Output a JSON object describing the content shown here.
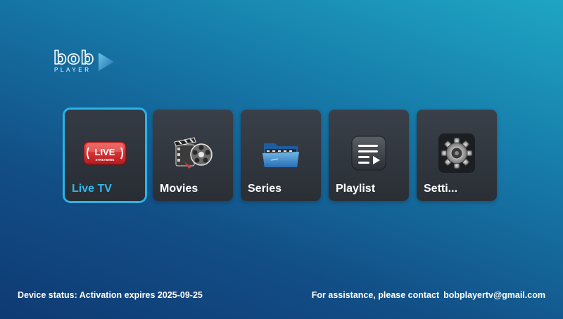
{
  "brand": {
    "wordmark": "bob",
    "sub": "PLAYER"
  },
  "menu": {
    "items": [
      {
        "label": "Live TV",
        "icon": "live-streaming-icon",
        "selected": true
      },
      {
        "label": "Movies",
        "icon": "film-reel-icon",
        "selected": false
      },
      {
        "label": "Series",
        "icon": "folder-film-icon",
        "selected": false
      },
      {
        "label": "Playlist",
        "icon": "playlist-icon",
        "selected": false
      },
      {
        "label": "Setti...",
        "icon": "gear-icon",
        "selected": false
      }
    ],
    "live_badge": {
      "text": "LIVE",
      "sub": "STREAMING"
    }
  },
  "footer": {
    "device_status": "Device status: Activation expires 2025-09-25",
    "assistance": "For assistance, please contact",
    "email": "bobplayertv@gmail.com"
  },
  "colors": {
    "accent": "#27b4e8",
    "tile": "#323840",
    "live_red": "#d8262a"
  }
}
